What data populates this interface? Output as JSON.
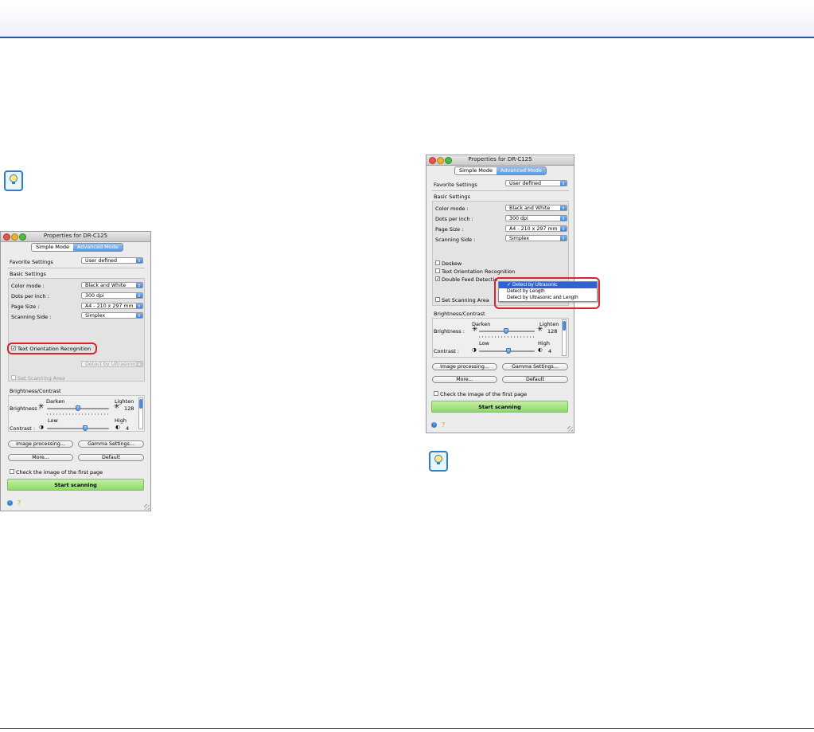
{
  "colors": {
    "header_rule": "#2d55a5",
    "accent_select": "#3e7fd7",
    "start_button": "#8fd66a",
    "highlight_ring": "#d7232a"
  },
  "icons": {
    "hint": "lightbulb-icon",
    "info": "info-icon",
    "help": "help-icon"
  },
  "dialog_left": {
    "title": "Properties for DR-C125",
    "tabs": [
      "Simple Mode",
      "Advanced Mode"
    ],
    "favorite_label": "Favorite Settings",
    "favorite_value": "User defined",
    "basic_settings": "Basic Settings",
    "color_mode_label": "Color mode :",
    "color_mode_value": "Black and White",
    "dpi_label": "Dots per inch :",
    "dpi_value": "300 dpi",
    "page_size_label": "Page Size :",
    "page_size_value": "A4 - 210 x 297 mm",
    "side_label": "Scanning Side :",
    "side_value": "Simplex",
    "text_orientation": "Text Orientation Recognition",
    "double_feed_value": "Detect by Ultrasonic",
    "set_area": "Set Scanning Area",
    "brightness_contrast": "Brightness/Contrast",
    "darken": "Darken",
    "lighten": "Lighten",
    "brightness_label": "Brightness :",
    "brightness_value": "128",
    "low": "Low",
    "high": "High",
    "contrast_label": "Contrast :",
    "contrast_value": "4",
    "image_processing": "Image processing...",
    "gamma": "Gamma Settings...",
    "more": "More...",
    "default": "Default",
    "check_first": "Check the image of the first page",
    "start": "Start scanning"
  },
  "dialog_right": {
    "title": "Properties for DR-C125",
    "tabs": [
      "Simple Mode",
      "Advanced Mode"
    ],
    "favorite_label": "Favorite Settings",
    "favorite_value": "User defined",
    "basic_settings": "Basic Settings",
    "color_mode_label": "Color mode :",
    "color_mode_value": "Black and White",
    "dpi_label": "Dots per inch :",
    "dpi_value": "300 dpi",
    "page_size_label": "Page Size :",
    "page_size_value": "A4 - 210 x 297 mm",
    "side_label": "Scanning Side :",
    "side_value": "Simplex",
    "deskew": "Deskew",
    "text_orientation": "Text Orientation Recognition",
    "double_feed": "Double Feed Detectio",
    "set_area": "Set Scanning Area",
    "menu_items": [
      "Detect by Ultrasonic",
      "Detect by Length",
      "Detect by Ultrasonic and Length"
    ],
    "menu_selected": "Detect by Ultrasonic",
    "brightness_contrast": "Brightness/Contrast",
    "darken": "Darken",
    "lighten": "Lighten",
    "brightness_label": "Brightness :",
    "brightness_value": "128",
    "low": "Low",
    "high": "High",
    "contrast_label": "Contrast :",
    "contrast_value": "4",
    "image_processing": "Image processing...",
    "gamma": "Gamma Settings...",
    "more": "More...",
    "default": "Default",
    "check_first": "Check the image of the first page",
    "start": "Start scanning"
  }
}
